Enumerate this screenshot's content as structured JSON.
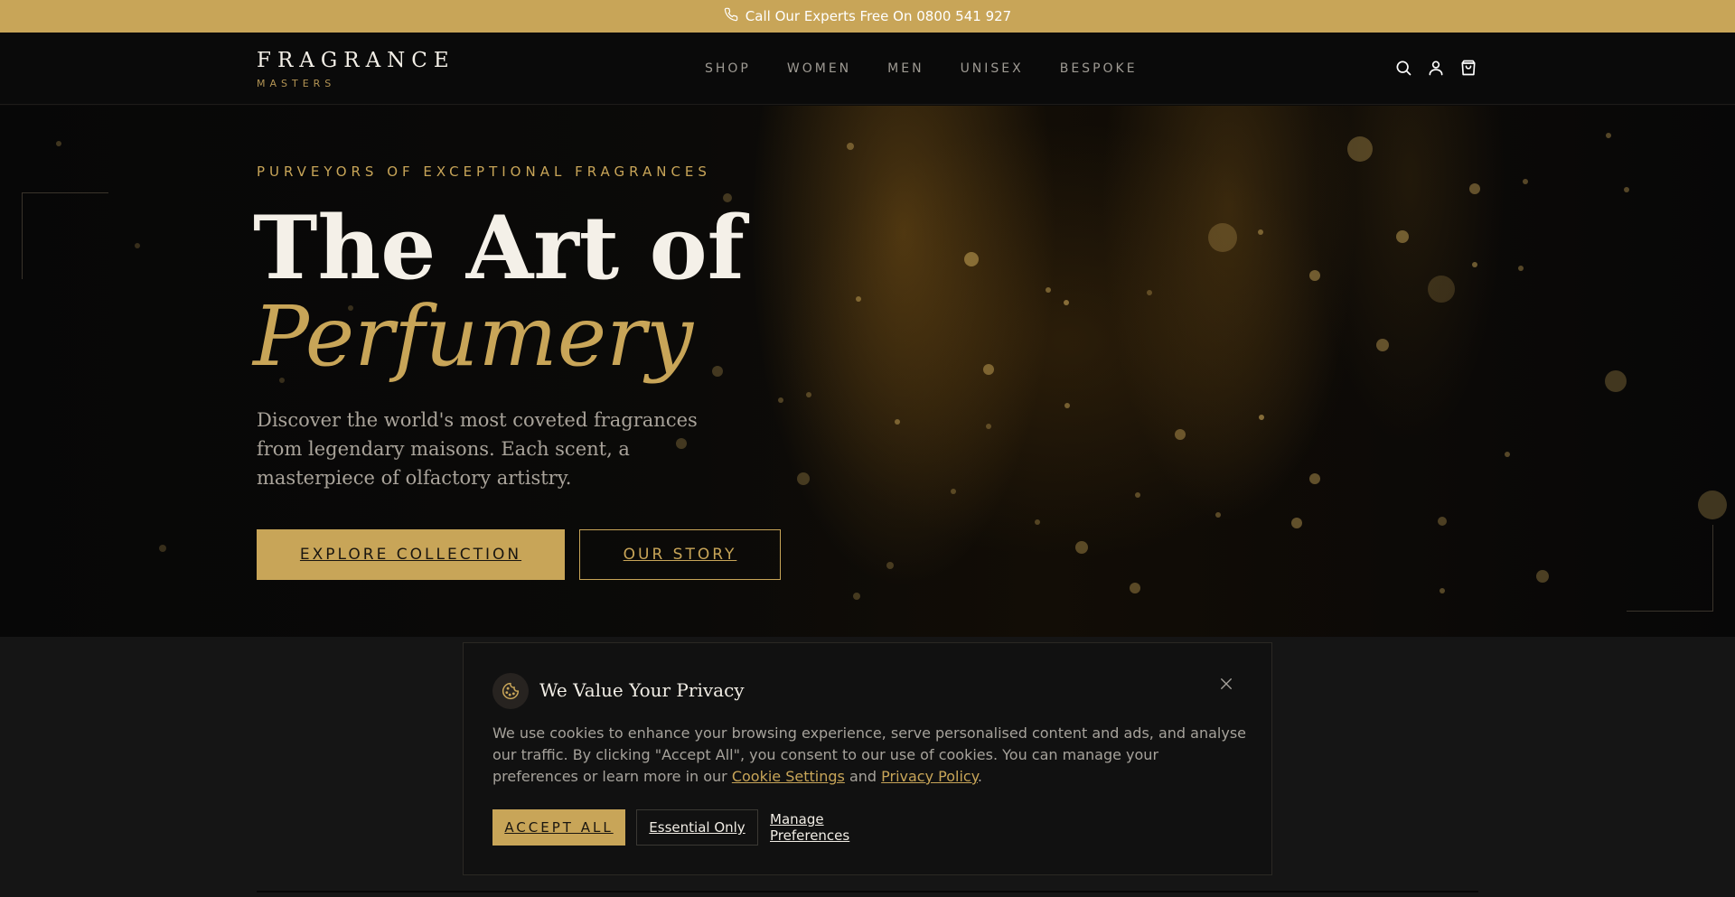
{
  "topbar": {
    "text": "Call Our Experts Free On 0800 541 927",
    "icon": "phone-icon"
  },
  "logo": {
    "main": "FRAGRANCE",
    "sub": "MASTERS"
  },
  "nav": {
    "items": [
      "SHOP",
      "WOMEN",
      "MEN",
      "UNISEX",
      "BESPOKE"
    ]
  },
  "header_icons": [
    "search-icon",
    "user-icon",
    "bag-icon"
  ],
  "hero": {
    "eyebrow": "PURVEYORS OF EXCEPTIONAL FRAGRANCES",
    "title_line1": "The Art of",
    "title_line2": "Perfumery",
    "description": "Discover the world's most coveted fragrances from legendary maisons. Each scent, a masterpiece of olfactory artistry.",
    "primary_button": "EXPLORE COLLECTION",
    "secondary_button": "OUR STORY"
  },
  "cookie": {
    "icon": "cookie-icon",
    "title": "We Value Your Privacy",
    "text_before": "We use cookies to enhance your browsing experience, serve personalised content and ads, and analyse our traffic. By clicking \"Accept All\", you consent to our use of cookies. You can manage your preferences or learn more in our ",
    "link_settings": "Cookie Settings",
    "text_and": " and ",
    "link_policy": "Privacy Policy",
    "text_end": ".",
    "accept_all": "ACCEPT ALL",
    "essential_only": "Essential Only",
    "manage_preferences": "Manage Preferences"
  },
  "colors": {
    "gold": "#c8a558",
    "background": "#0b0a09",
    "panel": "#111111"
  }
}
